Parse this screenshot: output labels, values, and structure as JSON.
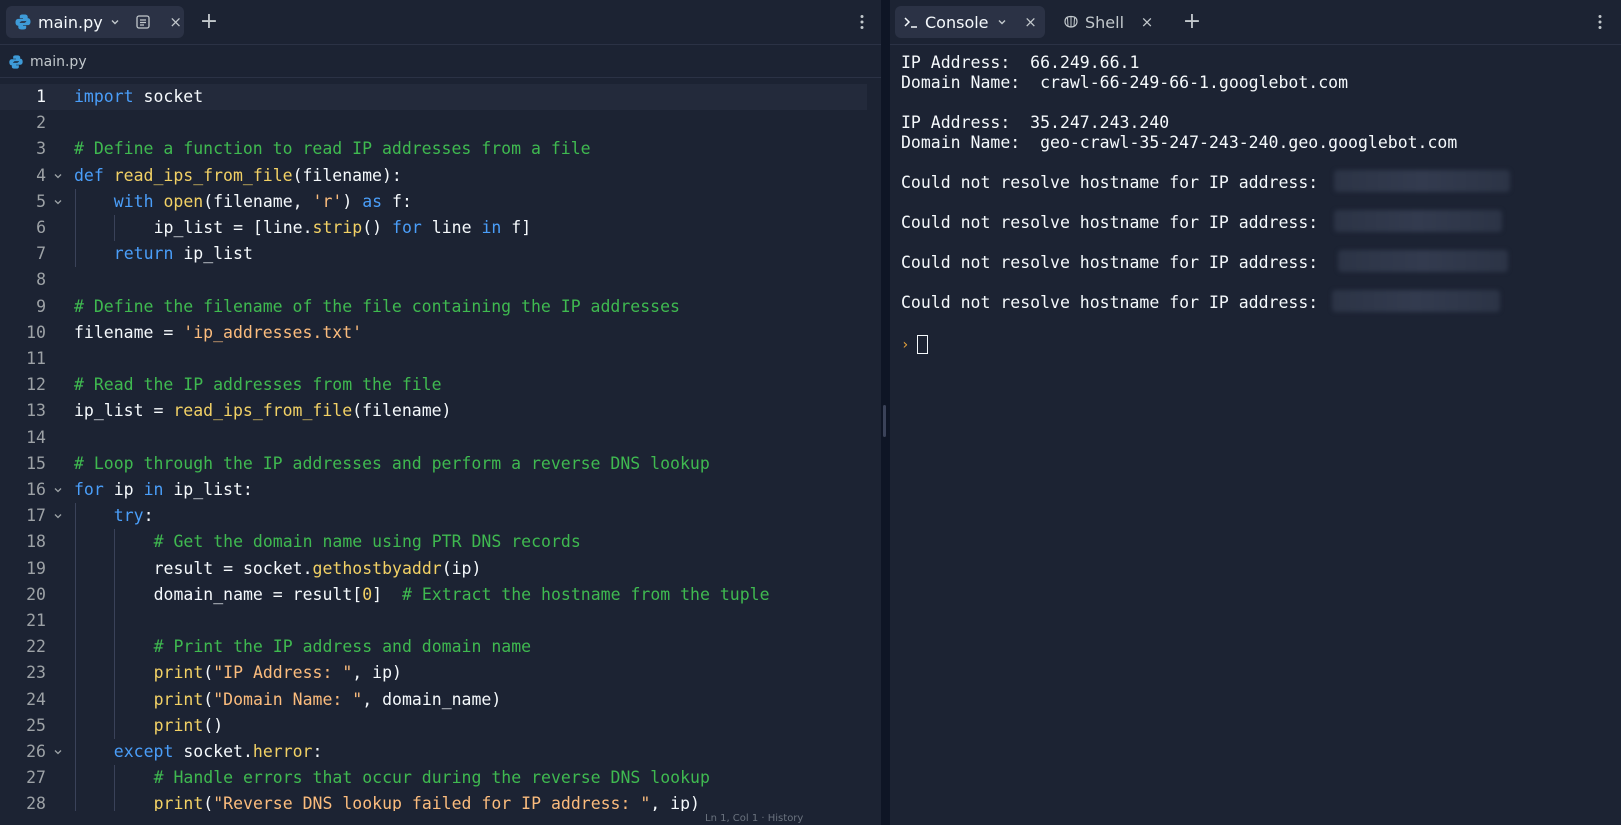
{
  "editor": {
    "tab": {
      "label": "main.py",
      "close": "×"
    },
    "new_tab": "+",
    "breadcrumb": "main.py",
    "status_partial": "Ln 1, Col 1 · History"
  },
  "code": {
    "lines": [
      {
        "n": "1",
        "tokens": [
          {
            "t": "import",
            "c": "kw"
          },
          {
            "t": " socket"
          }
        ]
      },
      {
        "n": "2",
        "tokens": []
      },
      {
        "n": "3",
        "tokens": [
          {
            "t": "# Define a function to read IP addresses from a file",
            "c": "com"
          }
        ]
      },
      {
        "n": "4",
        "fold": true,
        "tokens": [
          {
            "t": "def",
            "c": "kw"
          },
          {
            "t": " "
          },
          {
            "t": "read_ips_from_file",
            "c": "fn"
          },
          {
            "t": "(filename):"
          }
        ]
      },
      {
        "n": "5",
        "fold": true,
        "indent": 1,
        "tokens": [
          {
            "t": "with",
            "c": "kw"
          },
          {
            "t": " "
          },
          {
            "t": "open",
            "c": "fn"
          },
          {
            "t": "(filename, "
          },
          {
            "t": "'r'",
            "c": "str"
          },
          {
            "t": ") "
          },
          {
            "t": "as",
            "c": "kw"
          },
          {
            "t": " f:"
          }
        ]
      },
      {
        "n": "6",
        "indent": 2,
        "tokens": [
          {
            "t": "ip_list = [line."
          },
          {
            "t": "strip",
            "c": "fn"
          },
          {
            "t": "() "
          },
          {
            "t": "for",
            "c": "kw"
          },
          {
            "t": " line "
          },
          {
            "t": "in",
            "c": "kw"
          },
          {
            "t": " f]"
          }
        ]
      },
      {
        "n": "7",
        "indent": 1,
        "tokens": [
          {
            "t": "return",
            "c": "kw"
          },
          {
            "t": " ip_list"
          }
        ]
      },
      {
        "n": "8",
        "tokens": []
      },
      {
        "n": "9",
        "tokens": [
          {
            "t": "# Define the filename of the file containing the IP addresses",
            "c": "com"
          }
        ]
      },
      {
        "n": "10",
        "tokens": [
          {
            "t": "filename = "
          },
          {
            "t": "'ip_addresses.txt'",
            "c": "str"
          }
        ]
      },
      {
        "n": "11",
        "tokens": []
      },
      {
        "n": "12",
        "tokens": [
          {
            "t": "# Read the IP addresses from the file",
            "c": "com"
          }
        ]
      },
      {
        "n": "13",
        "tokens": [
          {
            "t": "ip_list = "
          },
          {
            "t": "read_ips_from_file",
            "c": "fn"
          },
          {
            "t": "(filename)"
          }
        ]
      },
      {
        "n": "14",
        "tokens": []
      },
      {
        "n": "15",
        "tokens": [
          {
            "t": "# Loop through the IP addresses and perform a reverse DNS lookup",
            "c": "com"
          }
        ]
      },
      {
        "n": "16",
        "fold": true,
        "tokens": [
          {
            "t": "for",
            "c": "kw"
          },
          {
            "t": " ip "
          },
          {
            "t": "in",
            "c": "kw"
          },
          {
            "t": " ip_list:"
          }
        ]
      },
      {
        "n": "17",
        "fold": true,
        "indent": 1,
        "tokens": [
          {
            "t": "try",
            "c": "kw"
          },
          {
            "t": ":"
          }
        ]
      },
      {
        "n": "18",
        "indent": 2,
        "tokens": [
          {
            "t": "# Get the domain name using PTR DNS records",
            "c": "com"
          }
        ]
      },
      {
        "n": "19",
        "indent": 2,
        "tokens": [
          {
            "t": "result = socket."
          },
          {
            "t": "gethostbyaddr",
            "c": "fn"
          },
          {
            "t": "(ip)"
          }
        ]
      },
      {
        "n": "20",
        "indent": 2,
        "tokens": [
          {
            "t": "domain_name = result["
          },
          {
            "t": "0",
            "c": "num"
          },
          {
            "t": "]  "
          },
          {
            "t": "# Extract the hostname from the tuple",
            "c": "com"
          }
        ]
      },
      {
        "n": "21",
        "tokens": []
      },
      {
        "n": "22",
        "indent": 2,
        "tokens": [
          {
            "t": "# Print the IP address and domain name",
            "c": "com"
          }
        ]
      },
      {
        "n": "23",
        "indent": 2,
        "tokens": [
          {
            "t": "print",
            "c": "fn"
          },
          {
            "t": "("
          },
          {
            "t": "\"IP Address: \"",
            "c": "str"
          },
          {
            "t": ", ip)"
          }
        ]
      },
      {
        "n": "24",
        "indent": 2,
        "tokens": [
          {
            "t": "print",
            "c": "fn"
          },
          {
            "t": "("
          },
          {
            "t": "\"Domain Name: \"",
            "c": "str"
          },
          {
            "t": ", domain_name)"
          }
        ]
      },
      {
        "n": "25",
        "indent": 2,
        "tokens": [
          {
            "t": "print",
            "c": "fn"
          },
          {
            "t": "()"
          }
        ]
      },
      {
        "n": "26",
        "fold": true,
        "indent": 1,
        "tokens": [
          {
            "t": "except",
            "c": "kw"
          },
          {
            "t": " socket."
          },
          {
            "t": "herror",
            "c": "fn"
          },
          {
            "t": ":"
          }
        ]
      },
      {
        "n": "27",
        "indent": 2,
        "tokens": [
          {
            "t": "# Handle errors that occur during the reverse DNS lookup",
            "c": "com"
          }
        ]
      },
      {
        "n": "28",
        "indent": 2,
        "tokens": [
          {
            "t": "print",
            "c": "fn"
          },
          {
            "t": "("
          },
          {
            "t": "\"Reverse DNS lookup failed for IP address: \"",
            "c": "str"
          },
          {
            "t": ", ip)"
          }
        ]
      }
    ]
  },
  "console": {
    "tabs": [
      {
        "label": "Console",
        "close": "×"
      },
      {
        "label": "Shell",
        "close": "×"
      }
    ],
    "new_tab": "+",
    "output": [
      "IP Address:  66.249.66.1",
      "Domain Name:  crawl-66-249-66-1.googlebot.com",
      "IP Address:  35.247.243.240",
      "Domain Name:  geo-crawl-35-247-243-240.geo.googlebot.com",
      "Could not resolve hostname for IP address:",
      "Could not resolve hostname for IP address:",
      "Could not resolve hostname for IP address:",
      "Could not resolve hostname for IP address:"
    ],
    "prompt_symbol": "›"
  },
  "colors": {
    "background": "#1c2333",
    "keyword": "#4a9ef9",
    "comment": "#3fb950",
    "string": "#fbbc7d",
    "function": "#f2d165",
    "prompt": "#e5a13c"
  }
}
